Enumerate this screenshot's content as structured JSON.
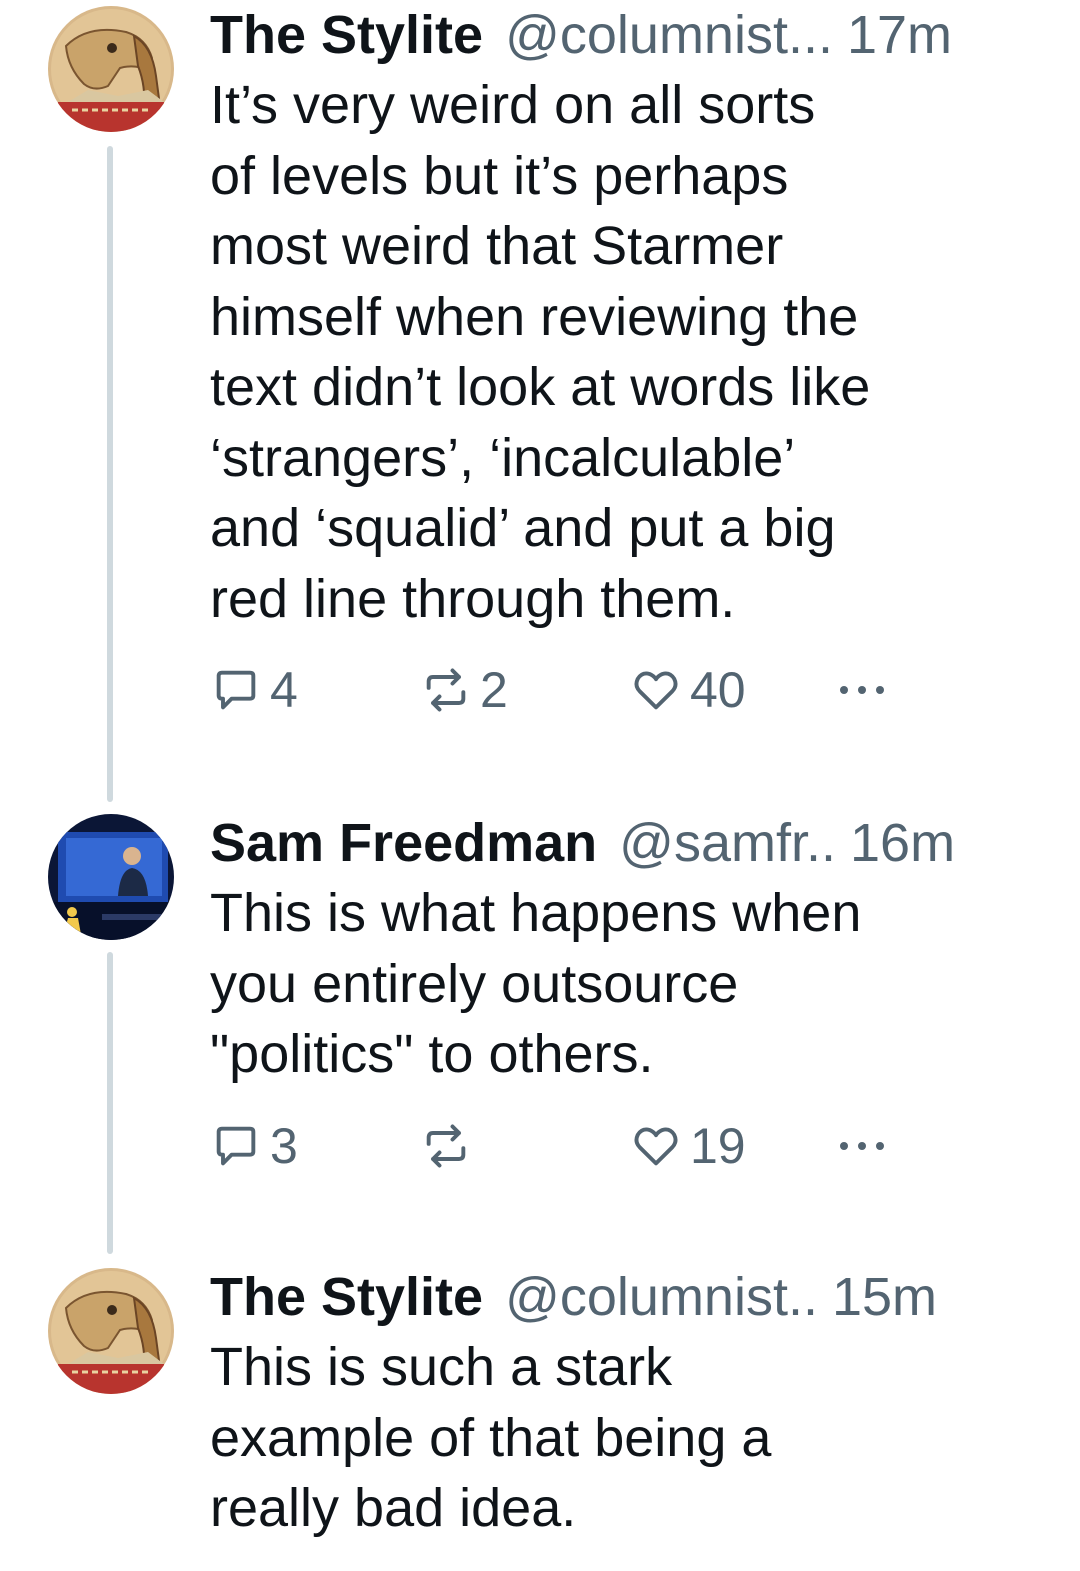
{
  "colors": {
    "text": "#0f1419",
    "secondary": "#536471",
    "connector": "#cfd9de"
  },
  "posts": [
    {
      "name": "The Stylite",
      "handle": "@columnist...",
      "time": "17m",
      "avatar_icon": "byzantine-icon-avatar",
      "lines": [
        "It’s very weird on all sorts",
        "of levels but it’s perhaps",
        "most weird that Starmer",
        "himself when reviewing the",
        "text didn’t look at words like",
        "‘strangers’, ‘incalculable’",
        "and ‘squalid’ and put a big",
        "red line through them."
      ],
      "replies": "4",
      "reposts": "2",
      "likes": "40"
    },
    {
      "name": "Sam Freedman",
      "handle": "@samfr..",
      "time": "16m",
      "avatar_icon": "stage-speaker-avatar",
      "lines": [
        "This is what happens when",
        "you entirely outsource",
        "\"politics\" to others."
      ],
      "replies": "3",
      "reposts": "",
      "likes": "19"
    },
    {
      "name": "The Stylite",
      "handle": "@columnist..",
      "time": "15m",
      "avatar_icon": "byzantine-icon-avatar",
      "lines": [
        "This is such a stark",
        "example of that being a",
        "really bad idea."
      ]
    }
  ]
}
